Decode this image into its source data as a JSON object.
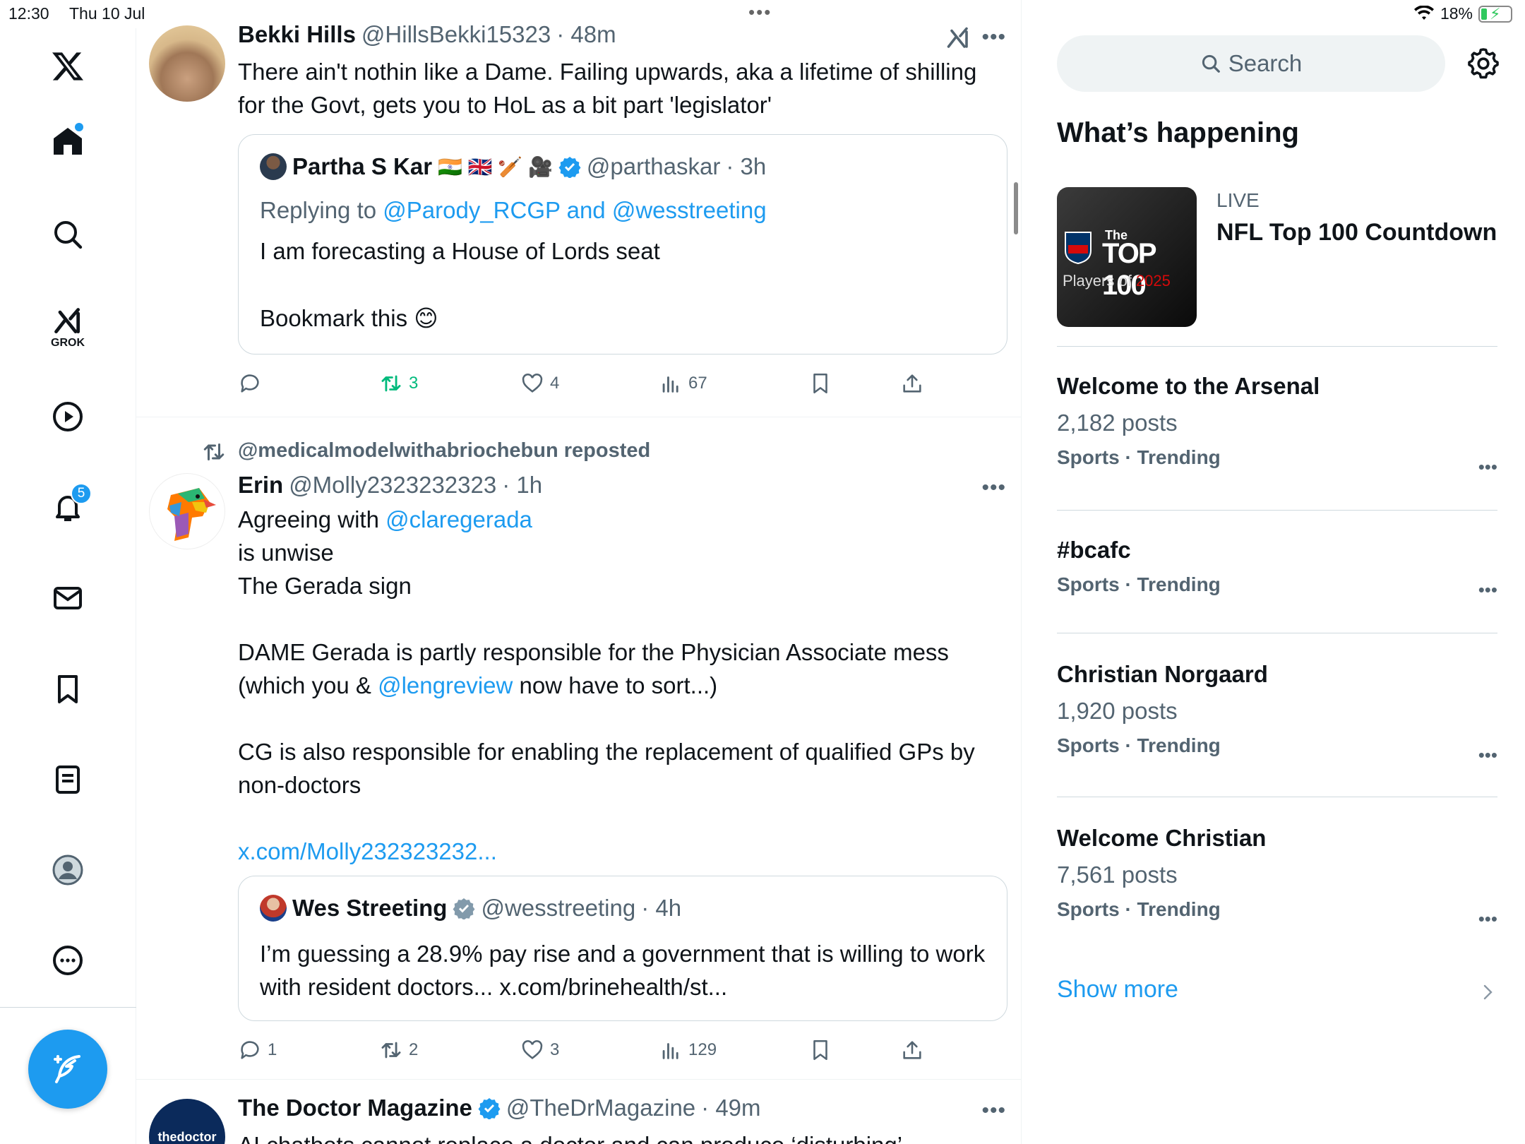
{
  "status": {
    "time": "12:30",
    "date": "Thu 10 Jul",
    "battery": "18%",
    "center_dots": "•••"
  },
  "nav": {
    "grok_label": "GROK",
    "notifications_badge": "5"
  },
  "posts": [
    {
      "name": "Bekki Hills",
      "handle": "@HillsBekki15323",
      "time": "· 48m",
      "text": "There ain't nothin like a Dame. Failing upwards, aka a lifetime of shilling for the Govt, gets you to HoL as a bit part 'legislator'",
      "quote": {
        "name": "Partha S Kar",
        "flags": "🇮🇳 🇬🇧 🏏 🎥",
        "handle": "@parthaskar",
        "time": "· 3h",
        "replying_prefix": "Replying to ",
        "replying_to": "@Parody_RCGP and @wesstreeting",
        "line1": "I am forecasting a House of Lords seat",
        "line2": "Bookmark this 😊"
      },
      "replies": "",
      "reposts": "3",
      "likes": "4",
      "views": "67"
    },
    {
      "reposted_by": "@medicalmodelwithabriochebun reposted",
      "name": "Erin",
      "handle": "@Molly2323232323",
      "time": "· 1h",
      "line1_prefix": "Agreeing with ",
      "line1_mention": "@claregerada",
      "line2": "is unwise",
      "line3": "The Gerada sign",
      "para2": "DAME Gerada is partly responsible for the Physician Associate mess",
      "para2b_prefix": "(which you & ",
      "para2b_mention": "@lengreview",
      "para2b_suffix": " now have to sort...)",
      "para3": "CG is also responsible for enabling the replacement of qualified GPs by non-doctors",
      "link": "x.com/Molly232323232...",
      "quote": {
        "name": "Wes Streeting",
        "handle": "@wesstreeting",
        "time": "· 4h",
        "text": "I’m guessing a 28.9% pay rise and a government that is willing to work with resident doctors... x.com/brinehealth/st..."
      },
      "replies": "1",
      "reposts": "2",
      "likes": "3",
      "views": "129"
    },
    {
      "name": "The Doctor Magazine",
      "handle": "@TheDrMagazine",
      "time": "· 49m",
      "avatar_text": "thedoctor",
      "text": "AI chatbots cannot replace a doctor and can produce ‘disturbing’"
    }
  ],
  "sidebar": {
    "search_placeholder": "Search",
    "heading": "What’s happening",
    "live": {
      "label": "LIVE",
      "title": "NFL Top 100 Countdown",
      "img_top": "The",
      "img_main": "TOP 100",
      "img_sub_a": "Players of ",
      "img_sub_b": "2025"
    },
    "trends": [
      {
        "title": "Welcome to the Arsenal",
        "posts": "2,182 posts",
        "category": "Sports · Trending"
      },
      {
        "title": "#bcafc",
        "posts": "",
        "category": "Sports · Trending"
      },
      {
        "title": "Christian Norgaard",
        "posts": "1,920 posts",
        "category": "Sports · Trending"
      },
      {
        "title": "Welcome Christian",
        "posts": "7,561 posts",
        "category": "Sports · Trending"
      }
    ],
    "show_more": "Show more"
  },
  "colors": {
    "accent": "#1d9bf0",
    "repost_green": "#00ba7c",
    "text": "#0f1419",
    "muted": "#536471"
  }
}
